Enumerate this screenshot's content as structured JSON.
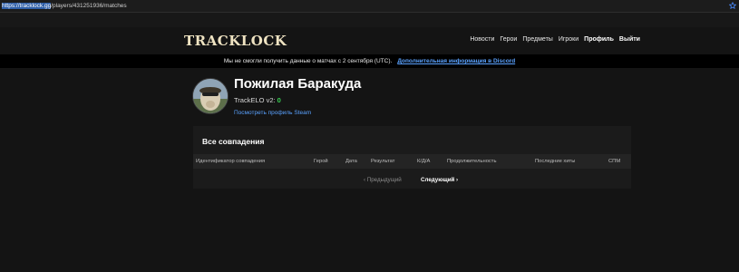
{
  "browser": {
    "url_selected": "https://tracklock.gg",
    "url_rest": "/players/431251936/matches"
  },
  "header": {
    "logo": "TRACKLOCK",
    "nav": [
      {
        "label": "Новости",
        "bold": false
      },
      {
        "label": "Герои",
        "bold": false
      },
      {
        "label": "Предметы",
        "bold": false
      },
      {
        "label": "Игроки",
        "bold": false
      },
      {
        "label": "Профиль",
        "bold": true
      },
      {
        "label": "Выйти",
        "bold": true
      }
    ]
  },
  "notice": {
    "text": "Мы не смогли получить данные о матчах с 2 сентября (UTC).",
    "link": "Дополнительная информация в Discord"
  },
  "profile": {
    "name": "Пожилая Баракуда",
    "elo_label": "TrackELO v2:",
    "elo_value": "0",
    "steam_link": "Посмотреть профиль Steam"
  },
  "matches": {
    "title": "Все совпадения",
    "columns": [
      "Идентификатор совпадения",
      "Герой",
      "Дата",
      "Результат",
      "К/Д/А",
      "Продолжительность",
      "Последние хиты",
      "СПМ"
    ],
    "prev_label": "‹ Предыдущий",
    "next_label": "Следующий ›"
  }
}
